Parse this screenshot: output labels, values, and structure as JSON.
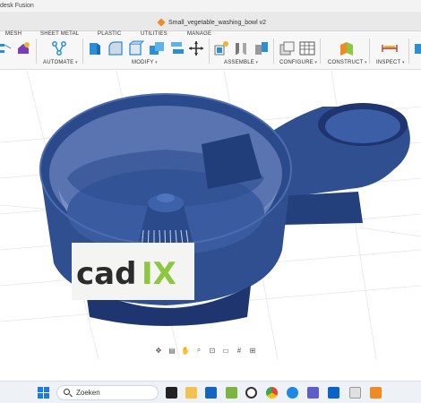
{
  "window": {
    "app_title": "desk Fusion",
    "document_tab": "Small_vegetable_washing_bowl v2"
  },
  "ribbon": {
    "menu_tabs": [
      "MESH",
      "SHEET METAL",
      "PLASTIC",
      "UTILITIES",
      "MANAGE"
    ],
    "groups": {
      "automate": "AUTOMATE",
      "modify": "MODIFY",
      "assemble": "ASSEMBLE",
      "configure": "CONFIGURE",
      "construct": "CONSTRUCT",
      "inspect": "INSPECT"
    }
  },
  "logo": {
    "text_main": "cad",
    "text_accent": "IX"
  },
  "taskbar": {
    "search_label": "Zoeken"
  },
  "colors": {
    "bowl_blue": "#2f4f91",
    "bowl_dark": "#1e3570",
    "accent_green": "#8dc63f",
    "ribbon_blue": "#2b8fd8"
  }
}
